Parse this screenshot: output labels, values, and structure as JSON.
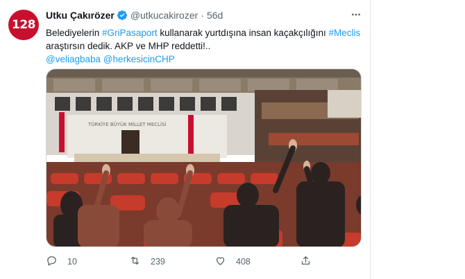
{
  "tweet": {
    "avatar_text": "128",
    "author_name": "Utku Çakırözer",
    "handle": "@utkucakirozer",
    "separator": "·",
    "age": "56d",
    "text": {
      "line1_plain_a": "Belediyelerin ",
      "hashtag_1": "#GriPasaport",
      "line1_plain_b": " kullanarak yurtdışına insan kaçakçılığını ",
      "hashtag_2": "#Meclis",
      "line2_plain": "araştırsın dedik. AKP ve MHP reddetti!..",
      "mention_1": "@veliagbaba",
      "mention_2": "@herkesicinCHP"
    },
    "media": {
      "chamber_banner_text": "TÜRKİYE BÜYÜK MİLLET MECLİSİ"
    },
    "actions": {
      "reply_count": "10",
      "retweet_count": "239",
      "like_count": "408"
    }
  },
  "colors": {
    "accent": "#1d9bf0",
    "avatar_bg": "#c8102e",
    "muted": "#536471"
  }
}
